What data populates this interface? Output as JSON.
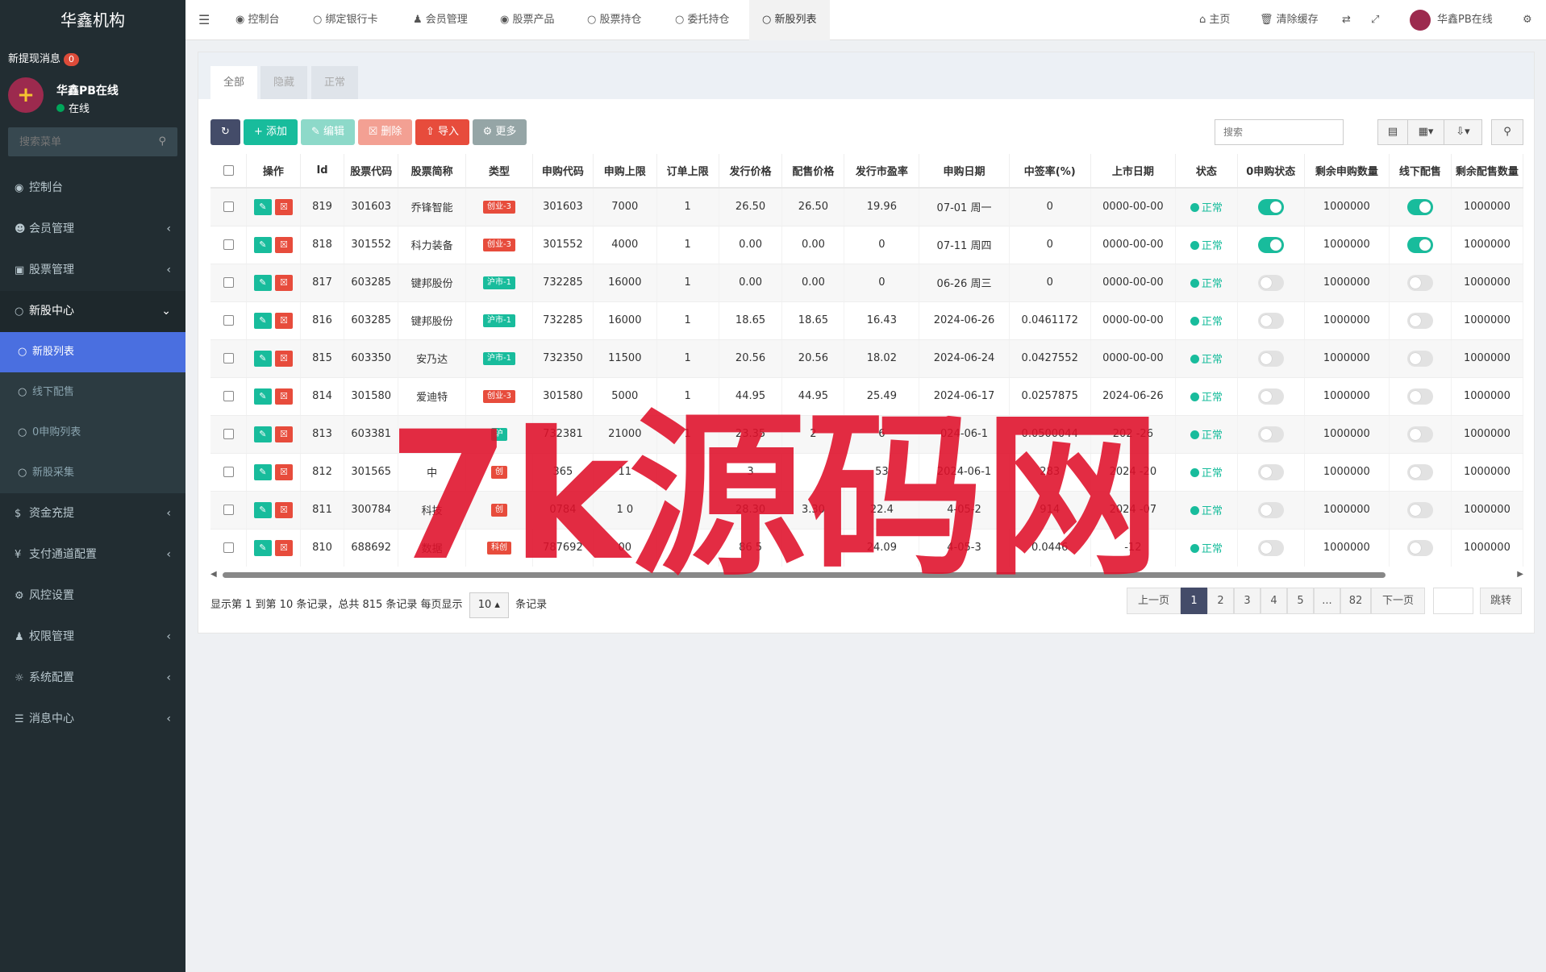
{
  "app": {
    "title": "华鑫机构"
  },
  "sidebar": {
    "notice_label": "新提现消息",
    "notice_count": "0",
    "user_name": "华鑫PB在线",
    "user_status": "在线",
    "search_placeholder": "搜索菜单",
    "menu": [
      {
        "label": "控制台",
        "icon": "dashboard-icon"
      },
      {
        "label": "会员管理",
        "icon": "user-icon"
      },
      {
        "label": "股票管理",
        "icon": "bank-icon"
      },
      {
        "label": "新股中心",
        "icon": "circle-icon"
      },
      {
        "label": "资金充提",
        "icon": "dollar-icon"
      },
      {
        "label": "支付通道配置",
        "icon": "yen-icon"
      },
      {
        "label": "风控设置",
        "icon": "gear-icon"
      },
      {
        "label": "权限管理",
        "icon": "users-icon"
      },
      {
        "label": "系统配置",
        "icon": "cog-icon"
      },
      {
        "label": "消息中心",
        "icon": "list-icon"
      }
    ],
    "submenu": [
      {
        "label": "新股列表"
      },
      {
        "label": "线下配售"
      },
      {
        "label": "0申购列表"
      },
      {
        "label": "新股采集"
      }
    ]
  },
  "topbar": {
    "tabs": [
      {
        "label": "控制台"
      },
      {
        "label": "绑定银行卡"
      },
      {
        "label": "会员管理"
      },
      {
        "label": "股票产品"
      },
      {
        "label": "股票持仓"
      },
      {
        "label": "委托持仓"
      },
      {
        "label": "新股列表"
      }
    ],
    "home_label": "主页",
    "clear_label": "清除缓存",
    "user_name": "华鑫PB在线"
  },
  "filter_tabs": [
    {
      "label": "全部"
    },
    {
      "label": "隐藏"
    },
    {
      "label": "正常"
    }
  ],
  "toolbar": {
    "add": "添加",
    "edit": "编辑",
    "delete": "删除",
    "import": "导入",
    "more": "更多",
    "search_placeholder": "搜索"
  },
  "table": {
    "columns": [
      "操作",
      "Id",
      "股票代码",
      "股票简称",
      "类型",
      "申购代码",
      "申购上限",
      "订单上限",
      "发行价格",
      "配售价格",
      "发行市盈率",
      "申购日期",
      "中签率(%)",
      "上市日期",
      "状态",
      "0申购状态",
      "剩余申购数量",
      "线下配售",
      "剩余配售数量"
    ],
    "rows": [
      {
        "id": "819",
        "code": "301603",
        "name": "乔锋智能",
        "type": "创业-3",
        "type_color": "#e74c3c",
        "sub_code": "301603",
        "sub_limit": "7000",
        "order_limit": "1",
        "price": "26.50",
        "place_price": "26.50",
        "pe": "19.96",
        "sub_date": "07-01 周一",
        "rate": "0",
        "list_date": "0000-00-00",
        "status": "正常",
        "zero_sub": true,
        "remain_sub": "1000000",
        "offline": true,
        "remain_place": "1000000"
      },
      {
        "id": "818",
        "code": "301552",
        "name": "科力装备",
        "type": "创业-3",
        "type_color": "#e74c3c",
        "sub_code": "301552",
        "sub_limit": "4000",
        "order_limit": "1",
        "price": "0.00",
        "place_price": "0.00",
        "pe": "0",
        "sub_date": "07-11 周四",
        "rate": "0",
        "list_date": "0000-00-00",
        "status": "正常",
        "zero_sub": true,
        "remain_sub": "1000000",
        "offline": true,
        "remain_place": "1000000"
      },
      {
        "id": "817",
        "code": "603285",
        "name": "键邦股份",
        "type": "沪市-1",
        "type_color": "#18bc9c",
        "sub_code": "732285",
        "sub_limit": "16000",
        "order_limit": "1",
        "price": "0.00",
        "place_price": "0.00",
        "pe": "0",
        "sub_date": "06-26 周三",
        "rate": "0",
        "list_date": "0000-00-00",
        "status": "正常",
        "zero_sub": false,
        "remain_sub": "1000000",
        "offline": false,
        "remain_place": "1000000"
      },
      {
        "id": "816",
        "code": "603285",
        "name": "键邦股份",
        "type": "沪市-1",
        "type_color": "#18bc9c",
        "sub_code": "732285",
        "sub_limit": "16000",
        "order_limit": "1",
        "price": "18.65",
        "place_price": "18.65",
        "pe": "16.43",
        "sub_date": "2024-06-26",
        "rate": "0.0461172",
        "list_date": "0000-00-00",
        "status": "正常",
        "zero_sub": false,
        "remain_sub": "1000000",
        "offline": false,
        "remain_place": "1000000"
      },
      {
        "id": "815",
        "code": "603350",
        "name": "安乃达",
        "type": "沪市-1",
        "type_color": "#18bc9c",
        "sub_code": "732350",
        "sub_limit": "11500",
        "order_limit": "1",
        "price": "20.56",
        "place_price": "20.56",
        "pe": "18.02",
        "sub_date": "2024-06-24",
        "rate": "0.0427552",
        "list_date": "0000-00-00",
        "status": "正常",
        "zero_sub": false,
        "remain_sub": "1000000",
        "offline": false,
        "remain_place": "1000000"
      },
      {
        "id": "814",
        "code": "301580",
        "name": "爱迪特",
        "type": "创业-3",
        "type_color": "#e74c3c",
        "sub_code": "301580",
        "sub_limit": "5000",
        "order_limit": "1",
        "price": "44.95",
        "place_price": "44.95",
        "pe": "25.49",
        "sub_date": "2024-06-17",
        "rate": "0.0257875",
        "list_date": "2024-06-26",
        "status": "正常",
        "zero_sub": false,
        "remain_sub": "1000000",
        "offline": false,
        "remain_place": "1000000"
      },
      {
        "id": "813",
        "code": "603381",
        "name": "",
        "type": "沪",
        "type_color": "#18bc9c",
        "sub_code": "732381",
        "sub_limit": "21000",
        "order_limit": "1",
        "price": "23.35",
        "place_price": "2",
        "pe": "6",
        "sub_date": "024-06-1",
        "rate": "0.0500044",
        "list_date": "202 -26",
        "status": "正常",
        "zero_sub": false,
        "remain_sub": "1000000",
        "offline": false,
        "remain_place": "1000000"
      },
      {
        "id": "812",
        "code": "301565",
        "name": "中",
        "type": "创",
        "type_color": "#e74c3c",
        "sub_code": "365",
        "sub_limit": "11",
        "order_limit": "",
        "price": "3",
        "place_price": "",
        "pe": "53",
        "sub_date": "2024-06-1",
        "rate": "283",
        "list_date": "2024 -20",
        "status": "正常",
        "zero_sub": false,
        "remain_sub": "1000000",
        "offline": false,
        "remain_place": "1000000"
      },
      {
        "id": "811",
        "code": "300784",
        "name": "科技",
        "type": "创",
        "type_color": "#e74c3c",
        "sub_code": "0784",
        "sub_limit": "1 0",
        "order_limit": "",
        "price": "28.30",
        "place_price": "3.30",
        "pe": "22.4",
        "sub_date": "4-05-2",
        "rate": "914",
        "list_date": "2024 -07",
        "status": "正常",
        "zero_sub": false,
        "remain_sub": "1000000",
        "offline": false,
        "remain_place": "1000000"
      },
      {
        "id": "810",
        "code": "688692",
        "name": "数据",
        "type": "科创",
        "type_color": "#e74c3c",
        "sub_code": "787692",
        "sub_limit": "00",
        "order_limit": "",
        "price": "86 5",
        "place_price": "",
        "pe": "24.09",
        "sub_date": "4-05-3",
        "rate": "0.0446",
        "list_date": "-12",
        "status": "正常",
        "zero_sub": false,
        "remain_sub": "1000000",
        "offline": false,
        "remain_place": "1000000"
      }
    ]
  },
  "pagination": {
    "info_prefix": "显示第 1 到第 10 条记录，总共 815 条记录 每页显示",
    "page_size": "10",
    "info_suffix": "条记录",
    "prev": "上一页",
    "pages": [
      "1",
      "2",
      "3",
      "4",
      "5",
      "...",
      "82"
    ],
    "next": "下一页",
    "jump": "跳转"
  },
  "watermark": {
    "text": "7k源码网",
    "color": "#e0102a"
  }
}
